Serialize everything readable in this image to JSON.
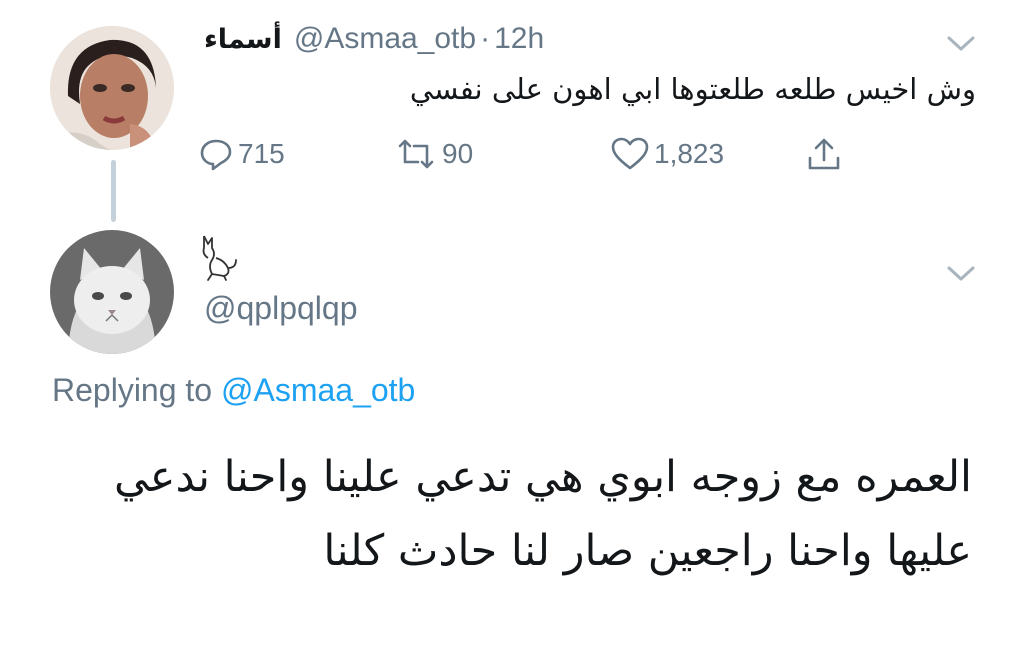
{
  "tweet1": {
    "display_name": "أسماء",
    "handle": "@Asmaa_otb",
    "separator": "·",
    "time": "12h",
    "text": "وش اخيس طلعه طلعتوها ابي اهون على نفسي",
    "actions": {
      "replies": "715",
      "retweets": "90",
      "likes": "1,823"
    },
    "icons": [
      "reply-icon",
      "retweet-icon",
      "like-icon",
      "share-icon",
      "chevron-down-icon"
    ]
  },
  "tweet2": {
    "display_name_icon": "cat-emoji",
    "handle": "@qplpqlqp",
    "replying_prefix": "Replying to",
    "replying_to": "@Asmaa_otb",
    "text_line1": "العمره مع زوجه ابوي هي تدعي علينا واحنا ندعي",
    "text_line2": "عليها واحنا راجعين صار لنا حادث كلنا"
  },
  "colors": {
    "secondary_text": "#657786",
    "link": "#1da1f2",
    "thread_line": "#c4d0da",
    "primary_text": "#14171a"
  }
}
